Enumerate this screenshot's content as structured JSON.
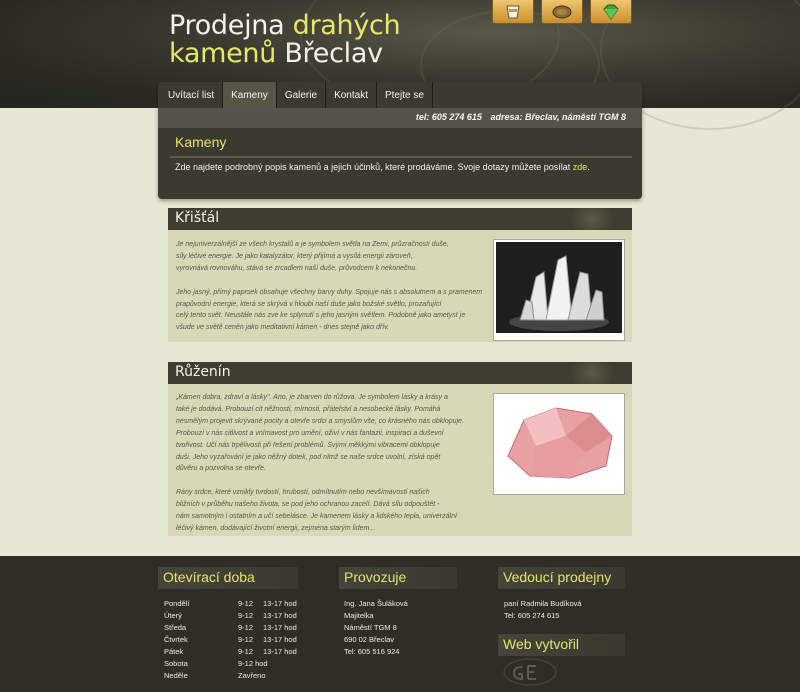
{
  "logo": {
    "line1a": "Prodejna ",
    "line1b": "drahých",
    "line2a": "kamenů",
    "line2b": " Břeclav"
  },
  "header_icons": [
    "cup-icon",
    "coin-icon",
    "gem-icon"
  ],
  "nav": [
    {
      "label": "Uvítací list",
      "active": false
    },
    {
      "label": "Kameny",
      "active": true
    },
    {
      "label": "Galerie",
      "active": false
    },
    {
      "label": "Kontakt",
      "active": false
    },
    {
      "label": "Ptejte se",
      "active": false
    }
  ],
  "contact": {
    "tel": "tel: 605 274 615",
    "address": "adresa: Břeclav, náměstí TGM 8"
  },
  "page": {
    "title": "Kameny",
    "intro": "Zde najdete podrobný popis kamenů a jejich účinků, které prodáváme. Svoje dotazy můžete posílat ",
    "link": "zde",
    "intro_end": "."
  },
  "stones": [
    {
      "name": "Křišťál",
      "lines": [
        "Je nejuniverzálnější ze všech krystalů a je symbolem světla na Zemi, průzračnosti duše,",
        "síly léčivé energie. Je jako katalyzátor, který přijímá a vysílá energii zároveň,",
        "vyrovnává rovnováhu, stává se zrcadlem naší duše, průvodcem k nekonečnu.",
        "",
        "Jeho jasný, přímý paprsek obsahuje všechny barvy duhy. Spojuje nás s absolutnem a s pramenem",
        "prapůvodní energie, která se skrývá v hloubi naší duše jako božské světlo, prozařující",
        "celý tento svět. Neustále nás zve ke splynutí s jeho jasným světlem. Podobně jako ametyst je",
        "všude ve světě ceněn jako meditativní kámen - dnes stejně jako dřív."
      ]
    },
    {
      "name": "Růženín",
      "lines": [
        "„Kámen dobra, zdraví a lásky\". Ano, je zbarven do růžova. Je symbolem lásky a krásy a",
        "také je dodává. Probouzí cit něžnosti, mírnosti, přátelství a nesobecké lásky. Pomáhá",
        "nesmělým projevit skrývané pocity a otevře srdci a smyslům vše, co krásného nás obklopuje.",
        "Probouzí v nás citlivost a vnímavost pro umění, oživí v nás fantazii, inspiraci a duševní",
        "tvořivost. Učí nás trpělivosti při řešení problémů. Svými měkkými vibracemi obklopuje",
        "duši. Jeho vyzařování je jako něžný dotek, pod nímž se naše srdce uvolní, získá opět",
        "důvěru a pozvolna se otevře.",
        "",
        "Rány srdce, které vznikly tvrdostí, hrubostí, odmítnutím nebo nevšímavostí našich",
        "bližních v průběhu našeho života, se pod jeho ochranou zacelí. Dává sílu odpouštět -",
        "nám samotným i ostatním a učí sebelásce. Je kamenem lásky a lidského tepla, univerzální",
        "léčivý kámen, dodávající životní energii, zejména starým lidem..."
      ]
    }
  ],
  "footer": {
    "hours_title": "Otevírací doba",
    "hours": [
      {
        "day": "Pondělí",
        "a": "9-12",
        "b": "13-17 hod"
      },
      {
        "day": "Úterý",
        "a": "9-12",
        "b": "13-17 hod"
      },
      {
        "day": "Středa",
        "a": "9-12",
        "b": "13-17 hod"
      },
      {
        "day": "Čtvrtek",
        "a": "9-12",
        "b": "13-17 hod"
      },
      {
        "day": "Pátek",
        "a": "9-12",
        "b": "13-17 hod"
      },
      {
        "day": "Sobota",
        "a": "9-12 hod",
        "b": ""
      },
      {
        "day": "Neděle",
        "a": "Zavřeno",
        "b": ""
      }
    ],
    "operator_title": "Provozuje",
    "operator": [
      "Ing. Jana Šuláková",
      "Majitelka",
      "Náměstí TGM 8",
      "690 02 Břeclav",
      "Tel: 605 516 924"
    ],
    "manager_title": "Vedoucí prodejny",
    "manager": [
      "paní Radmila Budíková",
      "Tel: 605 274 615"
    ],
    "web_title": "Web vytvořil"
  }
}
